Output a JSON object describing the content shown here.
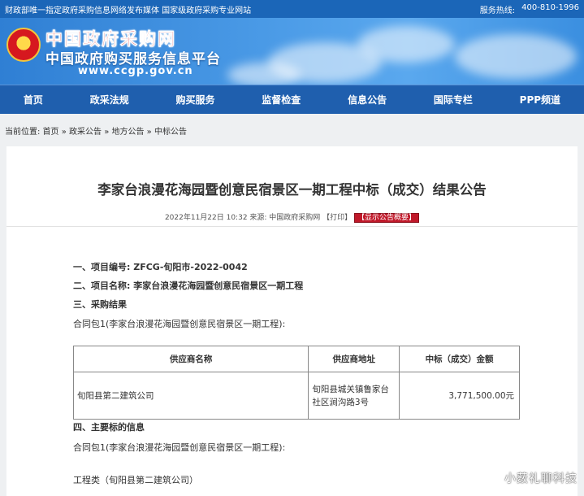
{
  "topbar": {
    "left_text": "财政部唯一指定政府采购信息网络发布媒体 国家级政府采购专业网站",
    "hotline_label": "服务热线:",
    "hotline_number": "400-810-1996"
  },
  "banner": {
    "title_main": "中国政府采购网",
    "title_sub": "中国政府购买服务信息平台",
    "url": "www.ccgp.gov.cn"
  },
  "nav": {
    "items": [
      "首页",
      "政采法规",
      "购买服务",
      "监督检查",
      "信息公告",
      "国际专栏",
      "PPP频道"
    ]
  },
  "breadcrumb": {
    "text": "当前位置: 首页 » 政采公告 » 地方公告 » 中标公告"
  },
  "article": {
    "title": "李家台浪漫花海园暨创意民宿景区一期工程中标（成交）结果公告",
    "meta": "2022年11月22日 10:32 来源: 中国政府采购网 【打印】",
    "meta_badge": "【显示公告概要】",
    "s1": "一、项目编号: ZFCG-旬阳市-2022-0042",
    "s2": "二、项目名称: 李家台浪漫花海园暨创意民宿景区一期工程",
    "s3": "三、采购结果",
    "package1": "合同包1(李家台浪漫花海园暨创意民宿景区一期工程):",
    "table": {
      "headers": [
        "供应商名称",
        "供应商地址",
        "中标（成交）金额"
      ],
      "rows": [
        [
          "旬阳县第二建筑公司",
          "旬阳县城关镇鲁家台社区涧沟路3号",
          "3,771,500.00元"
        ]
      ]
    },
    "s4": "四、主要标的信息",
    "package2": "合同包1(李家台浪漫花海园暨创意民宿景区一期工程):",
    "category": "工程类（旬阳县第二建筑公司）"
  },
  "watermark": "小薮礼聊科技",
  "colors": {
    "topbar": "#1b66b8",
    "nav": "#1f5fae",
    "badge": "#c0192a",
    "brand_red": "#d71920"
  }
}
